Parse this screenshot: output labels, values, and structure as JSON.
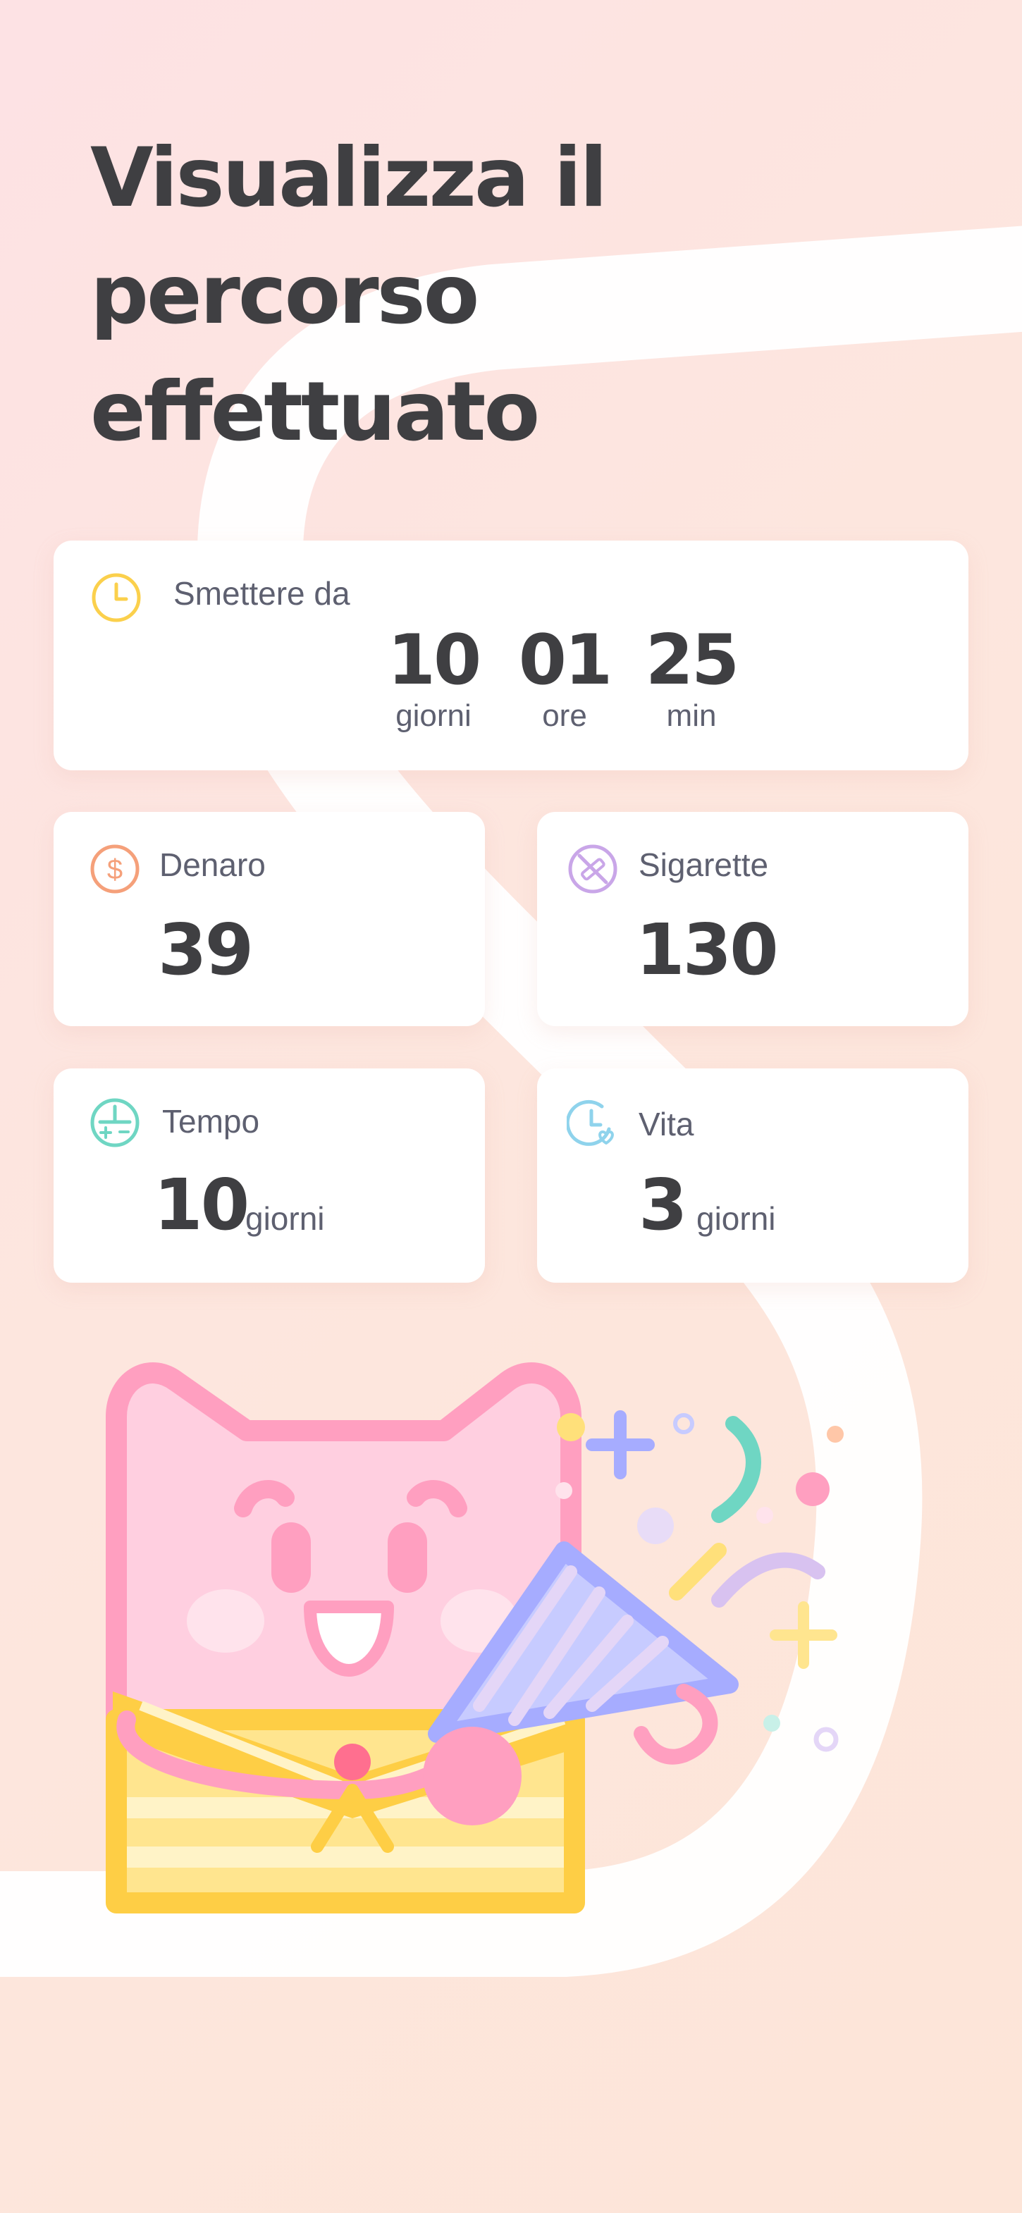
{
  "headline": {
    "line1": "Visualizza il",
    "line2": "percorso",
    "line3": "effettuato"
  },
  "quit_card": {
    "label": "Smettere da",
    "icon": "clock-icon",
    "days_value": "10",
    "days_unit": "giorni",
    "hours_value": "01",
    "hours_unit": "ore",
    "minutes_value": "25",
    "minutes_unit": "min"
  },
  "money_card": {
    "label": "Denaro",
    "icon": "dollar-coin-icon",
    "value": "39"
  },
  "cigarettes_card": {
    "label": "Sigarette",
    "icon": "no-smoking-icon",
    "value": "130"
  },
  "time_card": {
    "label": "Tempo",
    "icon": "time-plus-icon",
    "value": "10",
    "unit": "giorni"
  },
  "life_card": {
    "label": "Vita",
    "icon": "clock-heart-icon",
    "value": "3",
    "unit": "giorni"
  },
  "colors": {
    "clock": "#fbd04c",
    "money": "#f5a07a",
    "cigarettes": "#c9a6e8",
    "time": "#6fd6c3",
    "life": "#8fd3ec",
    "cat_pink": "#ffcfe0",
    "cat_outline": "#ff9fc0"
  }
}
